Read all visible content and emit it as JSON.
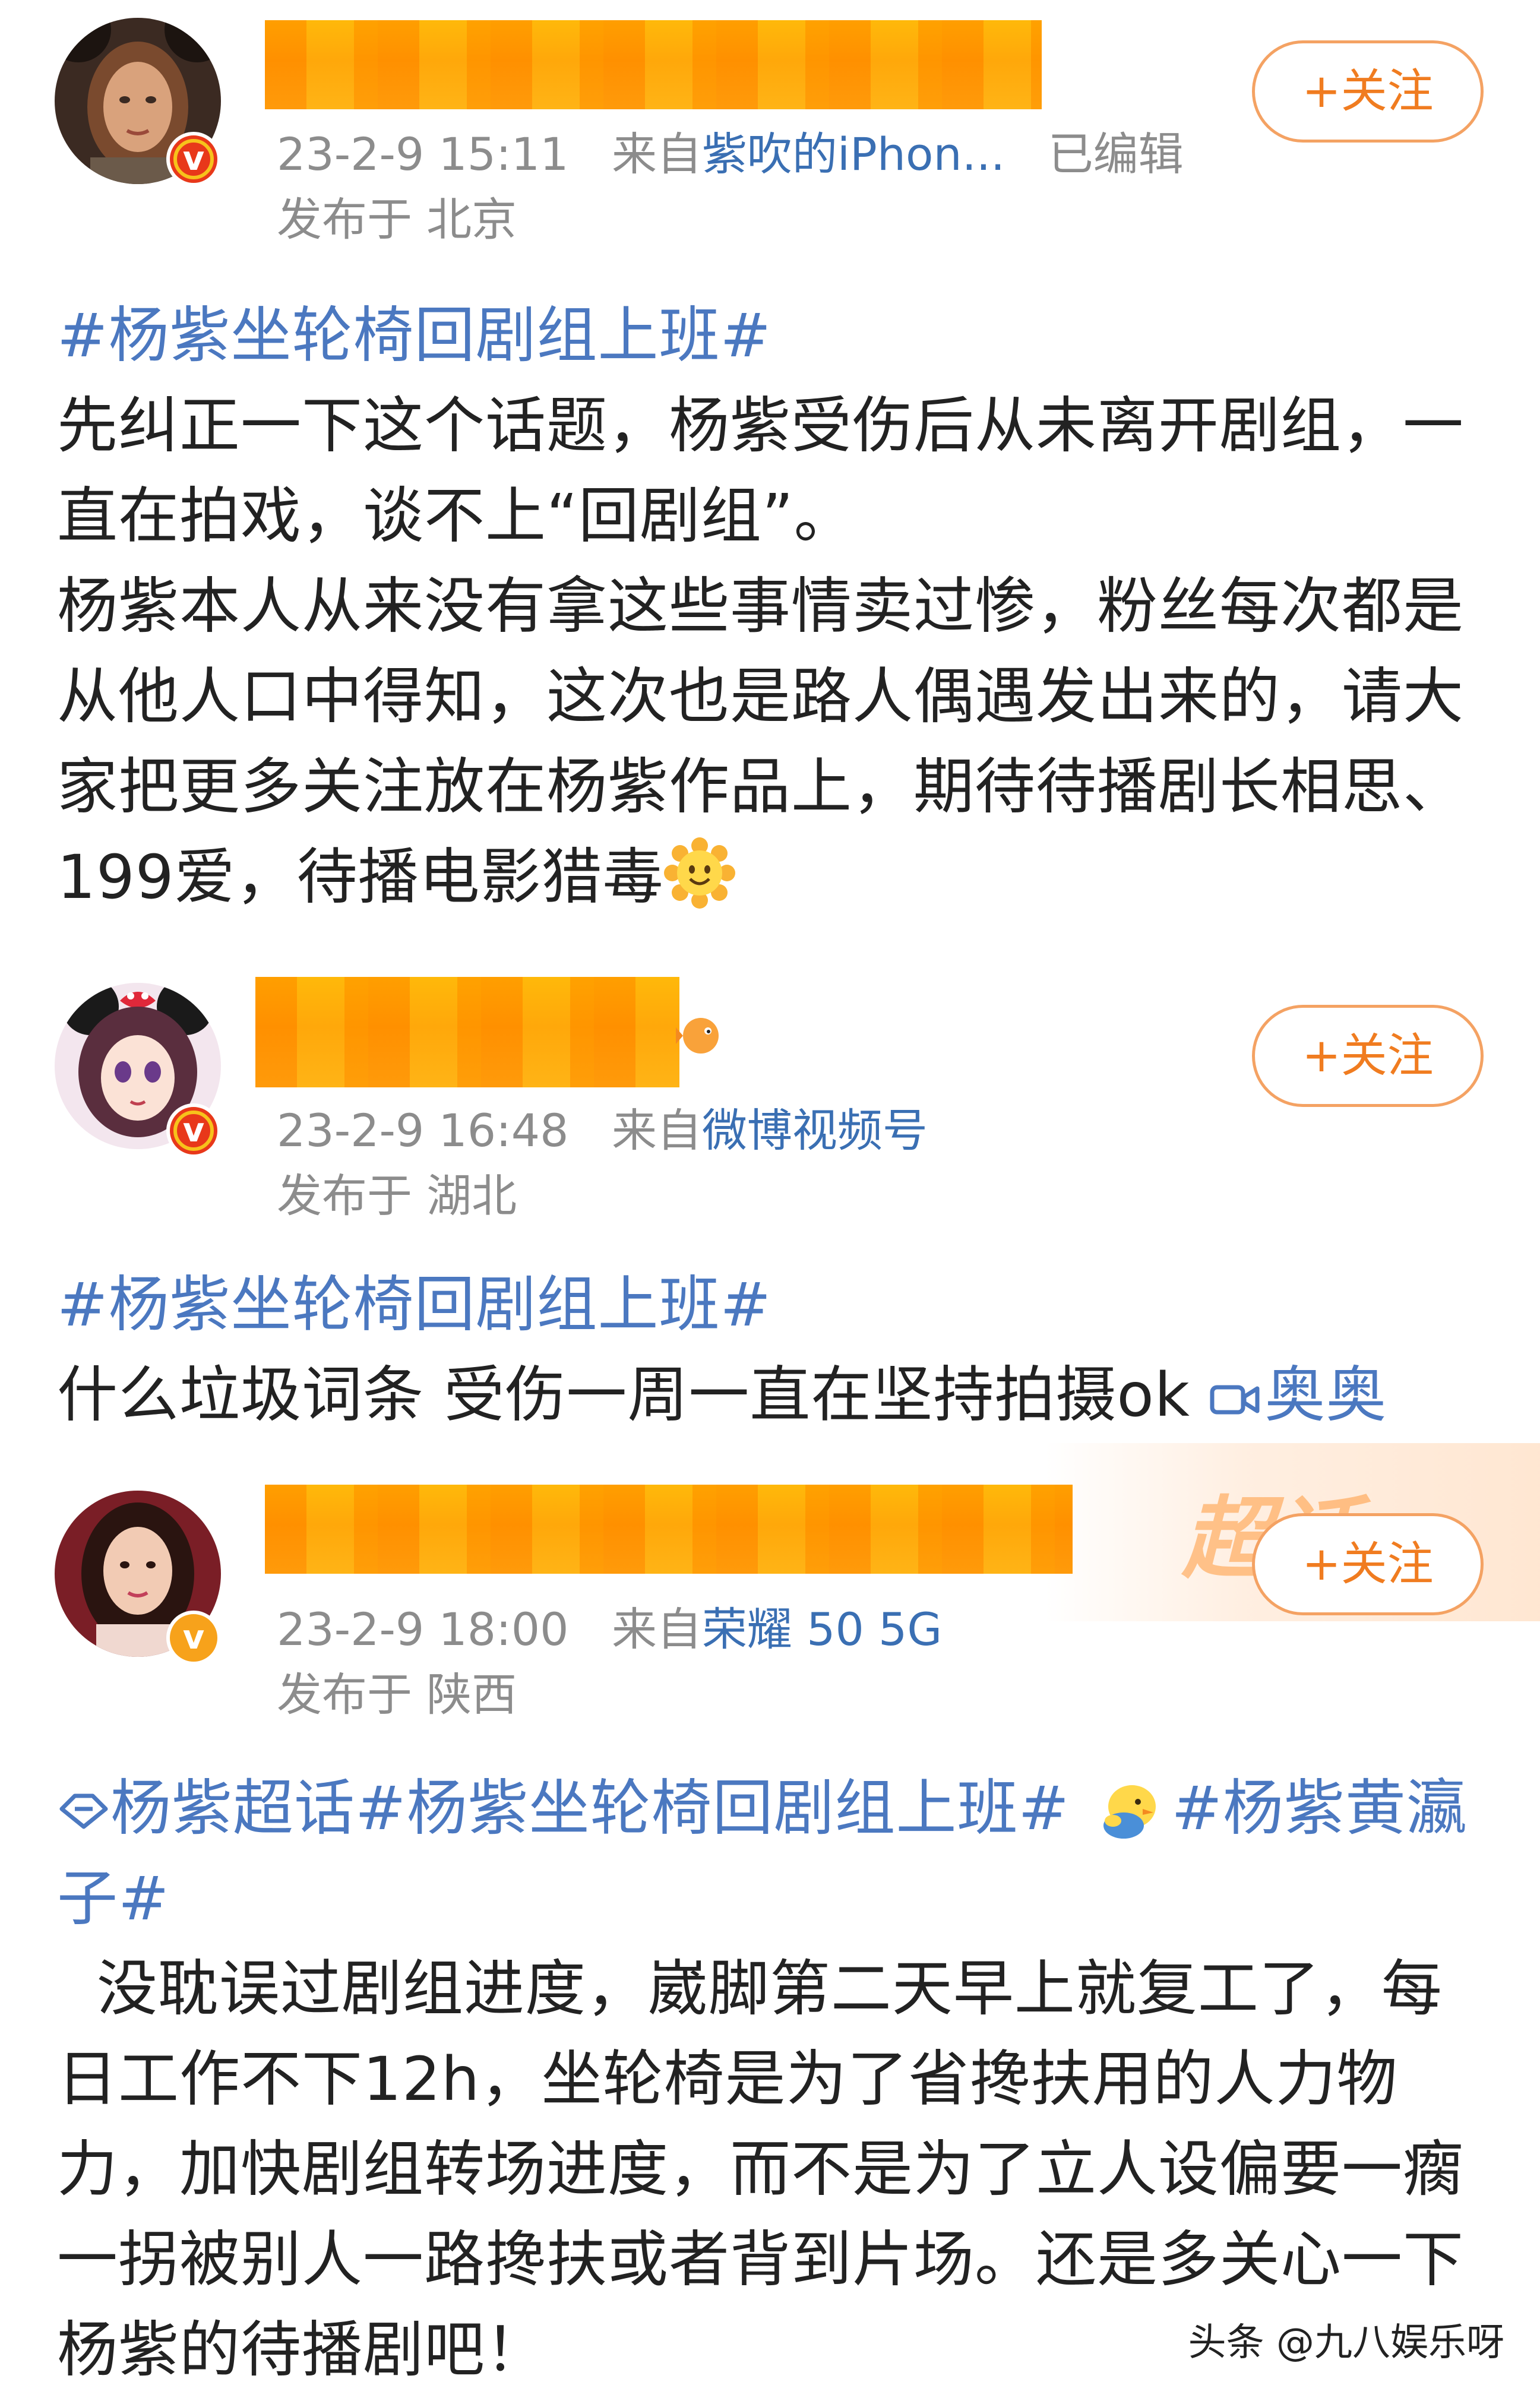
{
  "posts": [
    {
      "time": "23-2-9 15:11",
      "from_prefix": "来自",
      "source": "紫吹的iPhon...",
      "edited": "已编辑",
      "location": "发布于 北京",
      "follow_label": "+关注",
      "topic": "#杨紫坐轮椅回剧组上班#",
      "paragraphs": [
        "先纠正一下这个话题，杨紫受伤后从未离开剧组，一直在拍戏，谈不上“回剧组”。",
        "杨紫本人从来没有拿这些事情卖过惨，粉丝每次都是从他人口中得知，这次也是路人偶遇发出来的，请大家把更多关注放在杨紫作品上，期待待播剧长相思、199爱，待播电影猎毒"
      ],
      "emoji": "sun-smile-emoji"
    },
    {
      "time": "23-2-9 16:48",
      "from_prefix": "来自",
      "source": "微博视频号",
      "location": "发布于 湖北",
      "follow_label": "+关注",
      "topic": "#杨紫坐轮椅回剧组上班#",
      "text": "什么垃圾词条 受伤一周一直在坚持拍摄ok ",
      "video_link": "奥奥"
    },
    {
      "time": "23-2-9 18:00",
      "from_prefix": "来自",
      "source": "荣耀 50 5G",
      "location": "发布于 陕西",
      "follow_label": "+关注",
      "super_topic": "杨紫超话",
      "topic": "#杨紫坐轮椅回剧组上班#",
      "topic2": "#杨紫黄瀛子#",
      "paragraph": "  没耽误过剧组进度，崴脚第二天早上就复工了，每日工作不下12h，坐轮椅是为了省搀扶用的人力物力，加快剧组转场进度，而不是为了立人设偏要一瘸一拐被别人一路搀扶或者背到片场。还是多关心一下杨紫的待播剧吧！"
    }
  ],
  "banner_text": "超话",
  "watermark": "头条 @九八娱乐呀",
  "colors": {
    "follow": "#f07c20",
    "topic": "#4b78c0",
    "meta": "#8c8c8c"
  }
}
